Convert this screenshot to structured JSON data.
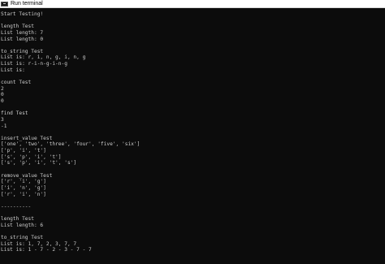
{
  "window": {
    "title": "Run terminal",
    "icon": "console-icon"
  },
  "console": {
    "lines": [
      "Start Testing!",
      "",
      "length Test",
      "List length: 7",
      "List length: 0",
      "",
      "to_string Test",
      "List is: r, i, n, g, i, n, g",
      "List is: r-i-n-g-i-n-g",
      "List is:",
      "",
      "count Test",
      "2",
      "0",
      "0",
      "",
      "find Test",
      "3",
      "-1",
      "",
      "insert_value Test",
      "['one', 'two', 'three', 'four', 'five', 'six']",
      "['p', 'i', 't']",
      "['s', 'p', 'i', 't']",
      "['s', 'p', 'i', 't', 's']",
      "",
      "remove_value Test",
      "['r', 'i', 'g']",
      "['i', 'n', 'g']",
      "['r', 'i', 'n']",
      "",
      "----------",
      "",
      "length Test",
      "List length: 6",
      "",
      "to_string Test",
      "List is: 1, 7, 2, 3, 7, 7",
      "List is: 1 - 7 - 2 - 3 - 7 - 7"
    ]
  }
}
